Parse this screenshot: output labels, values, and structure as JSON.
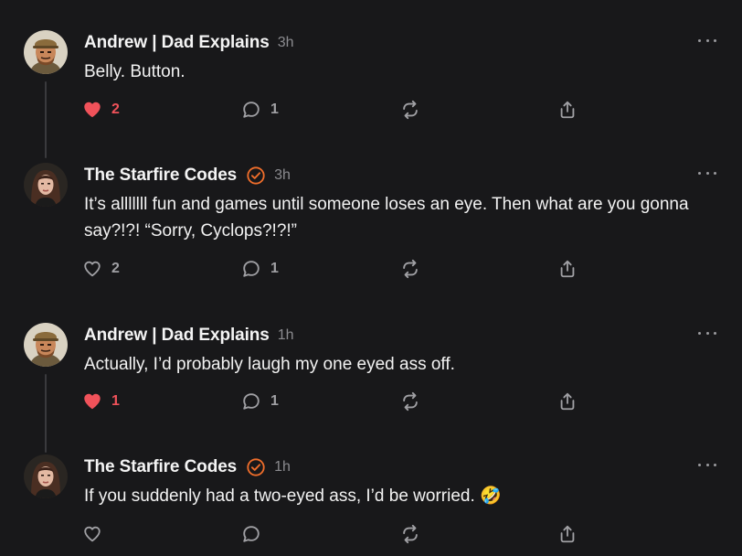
{
  "colors": {
    "background": "#18181a",
    "text": "#f2f2f2",
    "muted": "#8b8b8f",
    "like_active": "#f0525a",
    "verified": "#f06e2b",
    "thread_line": "#3a3a3d"
  },
  "posts": [
    {
      "author": "Andrew | Dad Explains",
      "verified": false,
      "time": "3h",
      "text": "Belly. Button.",
      "avatar": "bearded-man-avatar",
      "likes": "2",
      "liked": true,
      "replies": "1",
      "reposts": "",
      "has_thread_line": true
    },
    {
      "author": "The Starfire Codes",
      "verified": true,
      "time": "3h",
      "text": "It’s alllllll fun and games until someone loses an eye. Then what are you gonna say?!?! “Sorry, Cyclops?!?!”",
      "avatar": "woman-avatar",
      "likes": "2",
      "liked": false,
      "replies": "1",
      "reposts": "",
      "has_thread_line": false
    },
    {
      "author": "Andrew | Dad Explains",
      "verified": false,
      "time": "1h",
      "text": "Actually, I’d probably laugh my one eyed ass off.",
      "avatar": "bearded-man-avatar",
      "likes": "1",
      "liked": true,
      "replies": "1",
      "reposts": "",
      "has_thread_line": true
    },
    {
      "author": "The Starfire Codes",
      "verified": true,
      "time": "1h",
      "text": "If you suddenly had a two-eyed ass, I’d be worried. 🤣",
      "avatar": "woman-avatar",
      "likes": "",
      "liked": false,
      "replies": "",
      "reposts": "",
      "has_thread_line": false
    }
  ]
}
